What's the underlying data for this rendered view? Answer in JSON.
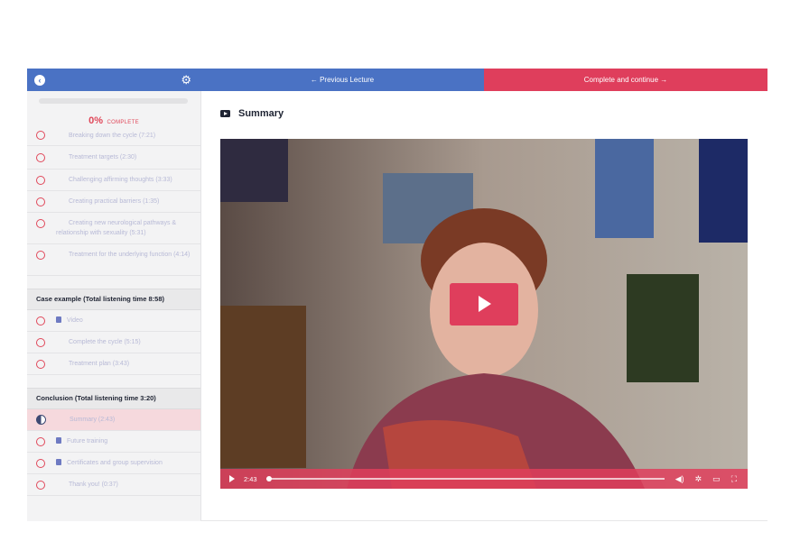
{
  "sidebar": {
    "progress": {
      "percent": "0%",
      "label": "COMPLETE"
    },
    "items_group1": [
      {
        "label": "Breaking down the cycle (7:21)"
      },
      {
        "label": "Treatment targets (2:30)"
      },
      {
        "label": "Challenging affirming thoughts (3:33)"
      },
      {
        "label": "Creating practical barriers (1:35)"
      },
      {
        "label": "Creating new neurological pathways & relationship with sexuality (5:31)"
      },
      {
        "label": "Treatment for the underlying function (4:14)"
      }
    ],
    "section2": {
      "title": "Case example (Total listening time 8:58)"
    },
    "items_group2": [
      {
        "label": "Video"
      },
      {
        "label": "Complete the cycle (5:15)"
      },
      {
        "label": "Treatment plan (3:43)"
      }
    ],
    "section3": {
      "title": "Conclusion (Total listening time 3:20)"
    },
    "items_group3": [
      {
        "label": "Summary (2:43)"
      },
      {
        "label": "Future training"
      },
      {
        "label": "Certificates and group supervision"
      },
      {
        "label": "Thank you! (0:37)"
      }
    ]
  },
  "nav": {
    "previous": "← Previous Lecture",
    "next": "Complete and continue →"
  },
  "lecture": {
    "title": "Summary"
  },
  "player": {
    "time": "2:43",
    "progress": 0.0
  },
  "colors": {
    "accent": "#df3e5c",
    "primary": "#4a72c4",
    "dark": "#1f2433"
  },
  "icons": [
    "back-icon",
    "gear-icon",
    "video-icon",
    "document-icon",
    "play-icon",
    "volume-icon",
    "settings-icon",
    "airplay-icon",
    "fullscreen-icon"
  ]
}
